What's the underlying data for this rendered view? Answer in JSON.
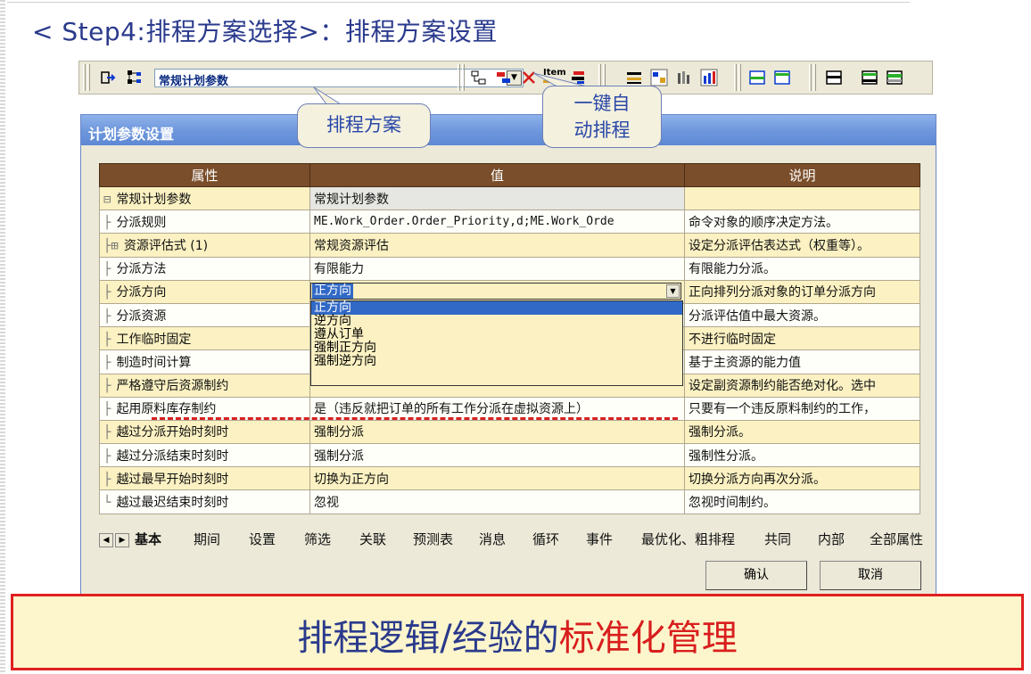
{
  "slide": {
    "title": "< Step4:排程方案选择>：排程方案设置"
  },
  "toolbar": {
    "combo_value": "常规计划参数",
    "icons": [
      "exit-icon",
      "tree-icon",
      "layout-icon",
      "bar-icon",
      "delete-icon",
      "item-icon",
      "gantt-icon",
      "grid-icon",
      "chart-icon",
      "histogram-icon",
      "panel-icon",
      "panel-icon",
      "window-icon",
      "window-icon",
      "window-icon"
    ],
    "icon_item_text": "Item"
  },
  "callouts": {
    "scheme": "排程方案",
    "auto_line1": "一键自",
    "auto_line2": "动排程"
  },
  "dialog": {
    "title": "计划参数设置",
    "headers": [
      "属性",
      "值",
      "说明"
    ],
    "rows": [
      {
        "tree": "⊟",
        "prop": "常规计划参数",
        "value": "常规计划参数",
        "desc": ""
      },
      {
        "tree": "├",
        "prop": "分派规则",
        "value": "ME.Work_Order.Order_Priority,d;ME.Work_Orde",
        "desc": "命令对象的顺序决定方法。"
      },
      {
        "tree": "├⊞",
        "prop": "资源评估式 (1)",
        "value": "常规资源评估",
        "desc": "设定分派评估表达式（权重等）。"
      },
      {
        "tree": "├",
        "prop": "分派方法",
        "value": "有限能力",
        "desc": "有限能力分派。"
      },
      {
        "tree": "├",
        "prop": "分派方向",
        "value": "正方向",
        "desc": "正向排列分派对象的订单分派方向"
      },
      {
        "tree": "├",
        "prop": "分派资源",
        "value": "",
        "desc": "分派评估值中最大资源。"
      },
      {
        "tree": "├",
        "prop": "工作临时固定",
        "value": "",
        "desc": "不进行临时固定"
      },
      {
        "tree": "├",
        "prop": "制造时间计算",
        "value": "",
        "desc": "基于主资源的能力值"
      },
      {
        "tree": "├",
        "prop": "严格遵守后资源制约",
        "value": "",
        "desc": "设定副资源制约能否绝对化。选中"
      },
      {
        "tree": "├",
        "prop": "起用原料库存制约",
        "value": "是（违反就把订单的所有工作分派在虚拟资源上）",
        "desc": "只要有一个违反原料制约的工作，"
      },
      {
        "tree": "├",
        "prop": "越过分派开始时刻时",
        "value": "强制分派",
        "desc": "强制分派。"
      },
      {
        "tree": "├",
        "prop": "越过分派结束时刻时",
        "value": "强制分派",
        "desc": "强制性分派。"
      },
      {
        "tree": "├",
        "prop": "越过最早开始时刻时",
        "value": "切换为正方向",
        "desc": "切换分派方向再次分派。"
      },
      {
        "tree": "└",
        "prop": "越过最迟结束时刻时",
        "value": "忽视",
        "desc": "忽视时间制约。"
      }
    ],
    "dropdown": {
      "selected": "正方向",
      "options": [
        "正方向",
        "逆方向",
        "遵从订单",
        "强制正方向",
        "强制逆方向"
      ]
    },
    "tabs": [
      "基本",
      "期间",
      "设置",
      "筛选",
      "关联",
      "预测表",
      "消息",
      "循环",
      "事件",
      "最优化、粗排程",
      "共同",
      "内部",
      "全部属性"
    ],
    "ok_label": "确认",
    "cancel_label": "取消"
  },
  "banner": {
    "part1": "排程逻辑/经验的",
    "part2": "标准化管理"
  },
  "colors": {
    "header_brown": "#7a4e2a",
    "row_yellow": "#fbf1c2",
    "banner_red": "#d81e1e",
    "title_blue": "#2a3a8c",
    "select_blue": "#3169c6"
  }
}
